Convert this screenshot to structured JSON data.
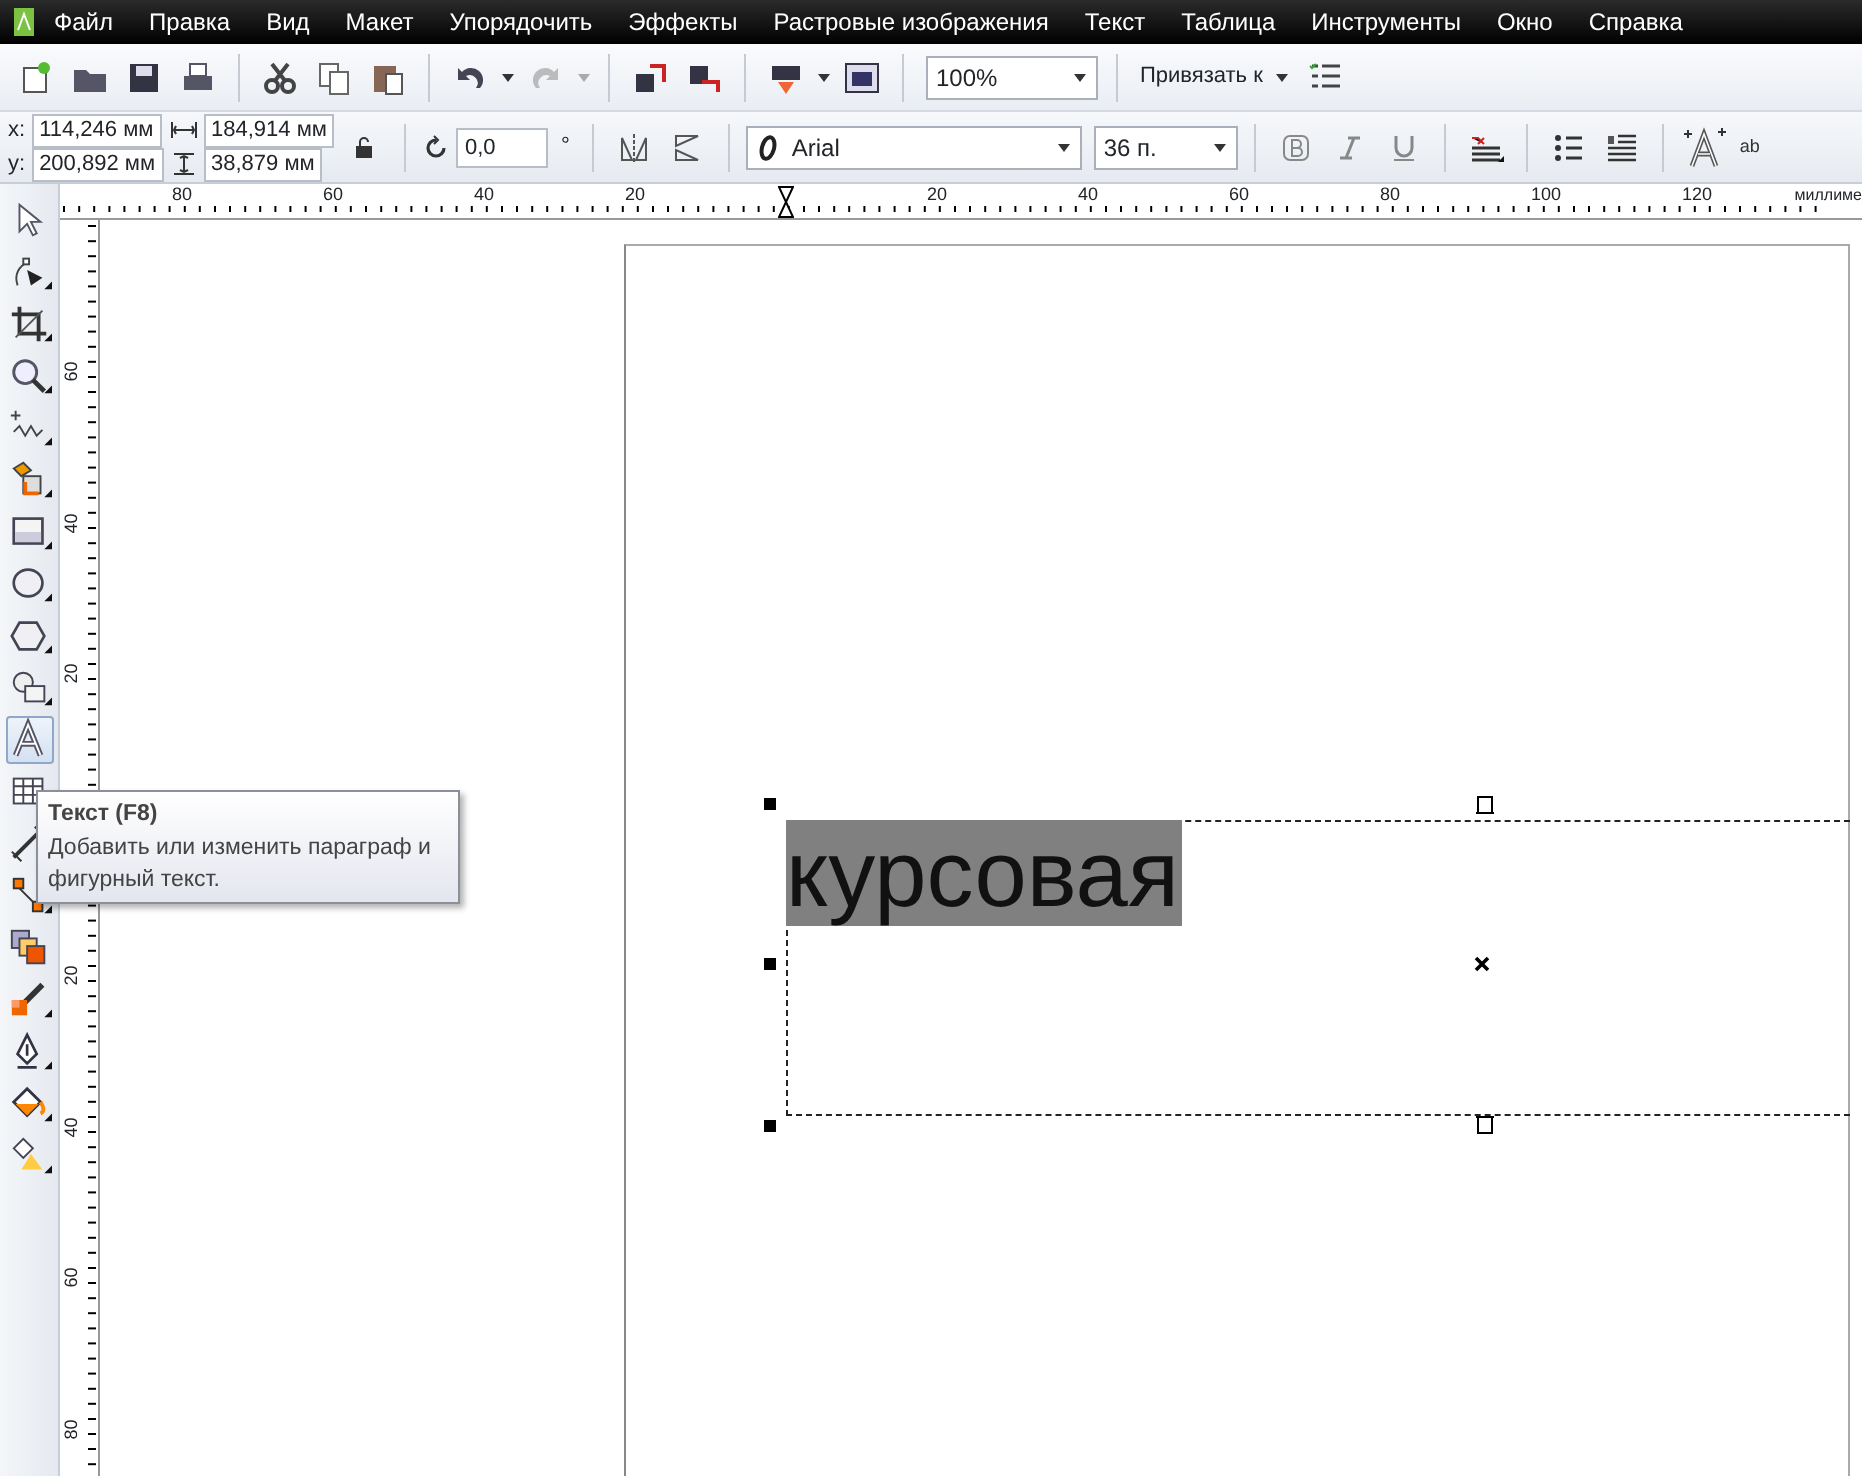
{
  "menu": [
    "Файл",
    "Правка",
    "Вид",
    "Макет",
    "Упорядочить",
    "Эффекты",
    "Растровые изображения",
    "Текст",
    "Таблица",
    "Инструменты",
    "Окно",
    "Справка"
  ],
  "toolbar": {
    "zoom": "100%",
    "snap": "Привязать к"
  },
  "property_bar": {
    "x_label": "x:",
    "x": "114,246 мм",
    "y_label": "y:",
    "y": "200,892 мм",
    "width": "184,914 мм",
    "height": "38,879 мм",
    "rotation": "0,0",
    "degree": "°",
    "font": "Arial",
    "font_size": "36 п.",
    "text_tool_label": "ab"
  },
  "toolbox": [
    {
      "kind": "pick",
      "selected": false
    },
    {
      "kind": "shape",
      "selected": false
    },
    {
      "kind": "crop",
      "selected": false
    },
    {
      "kind": "zoom",
      "selected": false
    },
    {
      "kind": "freehand",
      "selected": false
    },
    {
      "kind": "smartfill",
      "selected": false
    },
    {
      "kind": "rectangle",
      "selected": false
    },
    {
      "kind": "ellipse",
      "selected": false
    },
    {
      "kind": "polygon",
      "selected": false
    },
    {
      "kind": "shapes",
      "selected": false
    },
    {
      "kind": "text",
      "selected": true
    },
    {
      "kind": "table",
      "selected": false
    },
    {
      "kind": "dimension",
      "selected": false
    },
    {
      "kind": "connector",
      "selected": false
    },
    {
      "kind": "blend",
      "selected": false
    },
    {
      "kind": "eyedropper",
      "selected": false
    },
    {
      "kind": "pen",
      "selected": false
    },
    {
      "kind": "fill",
      "selected": false
    },
    {
      "kind": "interactivefill",
      "selected": false
    }
  ],
  "ruler_top": {
    "labels": [
      "80",
      "60",
      "40",
      "20",
      "20",
      "40",
      "60",
      "80",
      "100",
      "120"
    ],
    "unit": "миллиме"
  },
  "ruler_left": {
    "labels": [
      "60",
      "40",
      "20",
      "20",
      "40",
      "60",
      "80"
    ]
  },
  "canvas": {
    "text": "курсовая",
    "text_selected": true
  },
  "tooltip": {
    "title": "Текст (F8)",
    "body": "Добавить или изменить параграф и фигурный текст."
  }
}
